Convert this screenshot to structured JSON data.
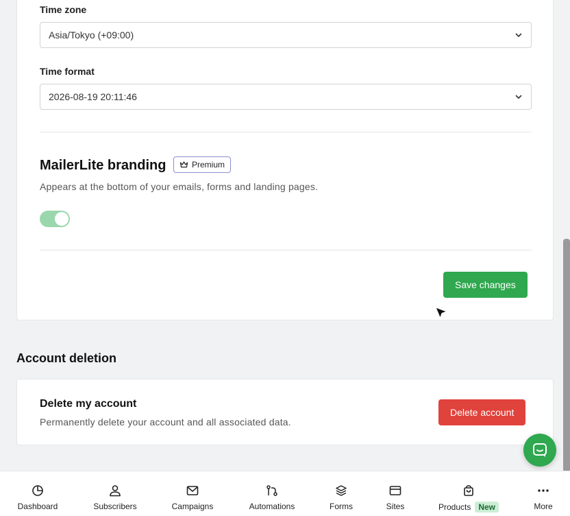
{
  "time_zone": {
    "label": "Time zone",
    "value": "Asia/Tokyo (+09:00)"
  },
  "time_format": {
    "label": "Time format",
    "value": "2026-08-19 20:11:46"
  },
  "branding": {
    "title": "MailerLite branding",
    "badge": "Premium",
    "description": "Appears at the bottom of your emails, forms and landing pages.",
    "toggle_on": true
  },
  "save_button": "Save changes",
  "account_deletion": {
    "heading": "Account deletion",
    "title": "Delete my account",
    "description": "Permanently delete your account and all associated data.",
    "button": "Delete account"
  },
  "colors": {
    "primary_green": "#2fa84f",
    "danger_red": "#e0423c",
    "premium_border": "#8a8fd0"
  },
  "bottom_nav": {
    "dashboard": "Dashboard",
    "subscribers": "Subscribers",
    "campaigns": "Campaigns",
    "automations": "Automations",
    "forms": "Forms",
    "sites": "Sites",
    "products": "Products",
    "products_badge": "New",
    "more": "More"
  }
}
